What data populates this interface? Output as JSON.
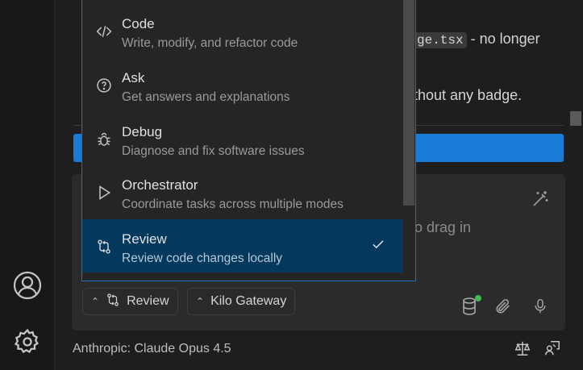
{
  "chat": {
    "code_ref": "ge.tsx",
    "line1_suffix": "- no longer",
    "line2_suffix": "thout any badge."
  },
  "input": {
    "placeholder_fragment": "o drag in"
  },
  "mode_menu": {
    "items": [
      {
        "title": "Code",
        "desc": "Write, modify, and refactor code",
        "icon": "code-icon"
      },
      {
        "title": "Ask",
        "desc": "Get answers and explanations",
        "icon": "question-circle-icon"
      },
      {
        "title": "Debug",
        "desc": "Diagnose and fix software issues",
        "icon": "bug-icon"
      },
      {
        "title": "Orchestrator",
        "desc": "Coordinate tasks across multiple modes",
        "icon": "play-outline-icon"
      },
      {
        "title": "Review",
        "desc": "Review code changes locally",
        "icon": "git-compare-icon",
        "selected": true
      }
    ]
  },
  "toolbar": {
    "mode_label": "Review",
    "gateway_label": "Kilo Gateway"
  },
  "status": {
    "model": "Anthropic: Claude Opus 4.5"
  },
  "colors": {
    "accent": "#1a7bd6",
    "selected_bg": "#04395e",
    "status_dot": "#3fb950"
  }
}
